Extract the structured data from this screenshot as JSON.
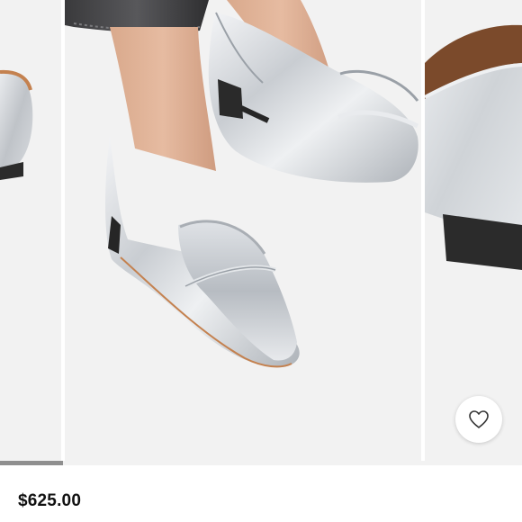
{
  "product": {
    "price": "$625.00"
  },
  "gallery": {
    "progress_fraction": 0.12
  },
  "icons": {
    "favorite": "heart-outline-icon"
  },
  "colors": {
    "background": "#ffffff",
    "photo_background": "#f2f2f2",
    "progress_track": "#f2f2f2",
    "progress_fill": "#8f8f8f",
    "price_text": "#111111"
  }
}
